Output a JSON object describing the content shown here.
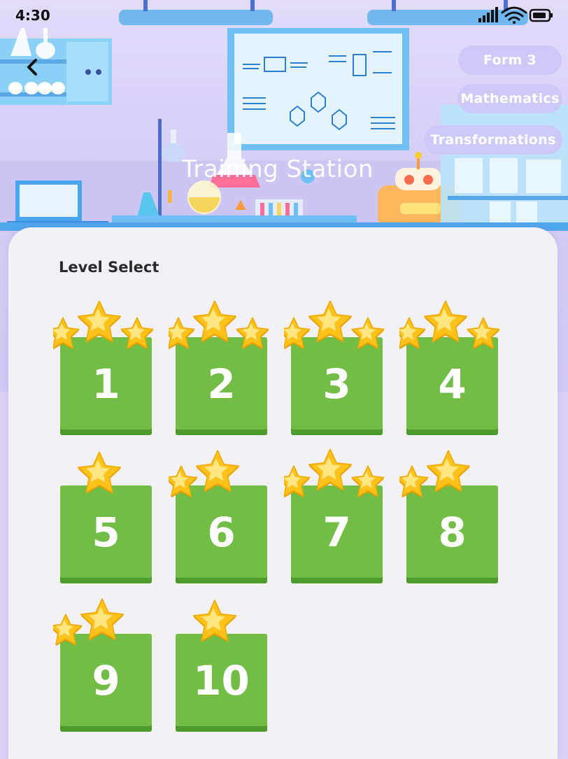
{
  "status_bar": {
    "time": "4:30"
  },
  "chips": {
    "form": "Form 3",
    "subject": "Mathematics",
    "topic": "Transformations"
  },
  "header": {
    "title": "Training Station"
  },
  "level_select": {
    "title": "Level Select",
    "levels": [
      {
        "label": "1",
        "stars": 3
      },
      {
        "label": "2",
        "stars": 3
      },
      {
        "label": "3",
        "stars": 3
      },
      {
        "label": "4",
        "stars": 3
      },
      {
        "label": "5",
        "stars": 1
      },
      {
        "label": "6",
        "stars": 2
      },
      {
        "label": "7",
        "stars": 3
      },
      {
        "label": "8",
        "stars": 2
      },
      {
        "label": "9",
        "stars": 2
      },
      {
        "label": "10",
        "stars": 1
      }
    ]
  },
  "colors": {
    "tile": "#72bd46",
    "tile_shadow": "#4f9a2c",
    "star": "#ffc21a",
    "panel": "#f2f1f4"
  }
}
